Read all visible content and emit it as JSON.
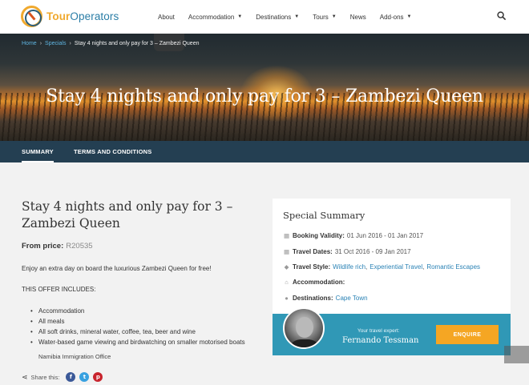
{
  "brand": {
    "name_part1": "Tour",
    "name_part2": "Operators",
    "colors": {
      "orange": "#f0a92e",
      "blue": "#2a7da6"
    }
  },
  "nav": {
    "items": [
      {
        "label": "About",
        "dropdown": false
      },
      {
        "label": "Accommodation",
        "dropdown": true
      },
      {
        "label": "Destinations",
        "dropdown": true
      },
      {
        "label": "Tours",
        "dropdown": true
      },
      {
        "label": "News",
        "dropdown": false
      },
      {
        "label": "Add-ons",
        "dropdown": true
      }
    ],
    "search_icon": "search-icon"
  },
  "breadcrumb": {
    "home": "Home",
    "specials": "Specials",
    "current": "Stay 4 nights and only pay for 3 – Zambezi Queen"
  },
  "hero": {
    "title": "Stay 4 nights and only pay for 3 – Zambezi Queen"
  },
  "tabs": {
    "summary": "SUMMARY",
    "terms": "TERMS AND CONDITIONS"
  },
  "main": {
    "title": "Stay 4 nights and only pay for 3 – Zambezi Queen",
    "price_label": "From price:",
    "price_value": "R20535",
    "intro": "Enjoy an extra day on board the luxurious Zambezi Queen for free!",
    "includes_heading": "THIS OFFER INCLUDES:",
    "includes": [
      "Accommodation",
      "All meals",
      "All soft drinks, mineral water, coffee, tea, beer and wine",
      "Water-based game viewing and birdwatching on smaller motorised boats"
    ],
    "overlap_text": "Namibia Immigration Office",
    "share_label": "Share this:"
  },
  "summary": {
    "title": "Special Summary",
    "booking_label": "Booking Validity:",
    "booking_value": "01 Jun 2016 - 01 Jan 2017",
    "travel_dates_label": "Travel Dates:",
    "travel_dates_value": "31 Oct 2016 - 09 Jan 2017",
    "travel_style_label": "Travel Style:",
    "travel_styles": [
      "Wildlife rich",
      "Experiential Travel",
      "Romantic Escapes"
    ],
    "accommodation_label": "Accommodation:",
    "destinations_label": "Destinations:",
    "destinations_value": "Cape Town",
    "expert_label": "Your travel expert:",
    "expert_name": "Fernando Tessman",
    "enquire_label": "ENQUIRE"
  },
  "colors": {
    "tabbar": "#243f52",
    "expert_bar": "#3098b6",
    "enquire": "#f5a623",
    "link": "#2a82b5"
  }
}
